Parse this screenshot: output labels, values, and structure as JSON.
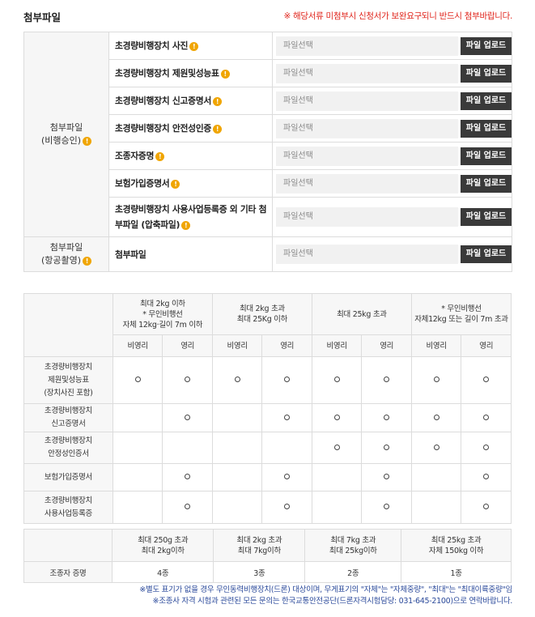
{
  "header": {
    "title": "첨부파일",
    "warning": "※ 해당서류 미첨부시 신청서가 보완요구되니 반드시 첨부바랍니다."
  },
  "attachments": {
    "group1": {
      "label": "첨부파일",
      "sublabel": "(비행승인)"
    },
    "group2": {
      "label": "첨부파일",
      "sublabel": "(항공촬영)"
    },
    "placeholder": "파일선택",
    "upload_label": "파일 업로드",
    "info_glyph": "!",
    "rows": [
      {
        "name": "초경량비행장치 사진"
      },
      {
        "name": "초경량비행장치 제원및성능표"
      },
      {
        "name": "초경량비행장치 신고증명서"
      },
      {
        "name": "초경량비행장치 안전성인증"
      },
      {
        "name": "조종자증명"
      },
      {
        "name": "보험가입증명서"
      },
      {
        "name": "초경량비행장치 사용사업등록증 외 기타 첨",
        "name2": "부파일 (압축파일)"
      },
      {
        "name": "첨부파일"
      }
    ]
  },
  "matrix": {
    "headers": [
      {
        "l1": "최대 2kg 이하",
        "l2": "* 무인비행선",
        "l3": "자체 12kg·길이 7m 이하"
      },
      {
        "l1": "최대 2kg 초과",
        "l2": "최대 25Kg 이하"
      },
      {
        "l1": "최대 25kg 초과"
      },
      {
        "l1": "* 무인비행선",
        "l2": "자체12kg 또는 길이 7m 초과"
      }
    ],
    "sub": [
      "비영리",
      "영리",
      "비영리",
      "영리",
      "비영리",
      "영리",
      "비영리",
      "영리"
    ],
    "rows": [
      {
        "l1": "초경량비행장치",
        "l2": "제원및성능표",
        "l3": "(장치사진 포함)",
        "marks": [
          true,
          true,
          true,
          true,
          true,
          true,
          true,
          true
        ]
      },
      {
        "l1": "초경량비행장치",
        "l2": "신고증명서",
        "marks": [
          false,
          true,
          false,
          true,
          true,
          true,
          true,
          true
        ]
      },
      {
        "l1": "초경량비행장치",
        "l2": "안정성인증서",
        "marks": [
          false,
          false,
          false,
          false,
          true,
          true,
          true,
          true
        ]
      },
      {
        "l1": "보험가입증명서",
        "marks": [
          false,
          true,
          false,
          true,
          false,
          true,
          false,
          true
        ]
      },
      {
        "l1": "초경량비행장치",
        "l2": "사용사업등록증",
        "marks": [
          false,
          true,
          false,
          true,
          false,
          true,
          false,
          true
        ]
      }
    ]
  },
  "pilot": {
    "headers": [
      {
        "l1": "최대 250g 초과",
        "l2": "최대 2kg이하"
      },
      {
        "l1": "최대 2kg 초과",
        "l2": "최대 7kg이하"
      },
      {
        "l1": "최대 7kg 초과",
        "l2": "최대 25kg이하"
      },
      {
        "l1": "최대 25kg 초과",
        "l2": "자체 150kg 이하"
      }
    ],
    "row_label": "조종자 증명",
    "values": [
      "4종",
      "3종",
      "2종",
      "1종"
    ]
  },
  "notes": {
    "line1": "※별도 표기가 없을 경우 무인동력비행장치(드론) 대상이며, 무게표기의 \"자체\"는 \"자체중량\", \"최대\"는 \"최대이륙중량\"임",
    "line2": "※조종사 자격 시험과 관련된 모든 문의는 한국교통안전공단(드론자격시험담당: 031-645-2100)으로 연락바랍니다."
  }
}
